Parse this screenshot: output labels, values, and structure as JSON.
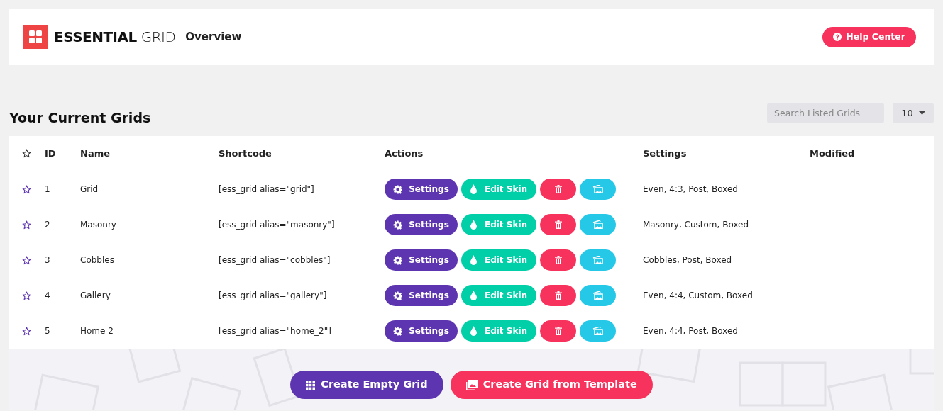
{
  "header": {
    "logo_bold": "ESSENTIAL",
    "logo_light": "GRID",
    "page_title": "Overview",
    "help_button": "Help Center"
  },
  "grids": {
    "title": "Your Current Grids",
    "search": {
      "placeholder": "Search Listed Grids"
    },
    "per_page": "10",
    "columns": [
      "ID",
      "Name",
      "Shortcode",
      "Actions",
      "Settings",
      "Modified"
    ],
    "rows": [
      {
        "id": "1",
        "name": "Grid",
        "shortcode": "[ess_grid alias=\"grid\"]",
        "settings_button": "Settings",
        "edit_skin_button": "Edit Skin",
        "settings": "Even, 4:3, Post, Boxed",
        "favorite": false
      },
      {
        "id": "2",
        "name": "Masonry",
        "shortcode": "[ess_grid alias=\"masonry\"]",
        "settings_button": "Settings",
        "edit_skin_button": "Edit Skin",
        "settings": "Masonry, Custom, Boxed",
        "favorite": false
      },
      {
        "id": "3",
        "name": "Cobbles",
        "shortcode": "[ess_grid alias=\"cobbles\"]",
        "settings_button": "Settings",
        "edit_skin_button": "Edit Skin",
        "settings": "Cobbles, Post, Boxed",
        "favorite": false
      },
      {
        "id": "4",
        "name": "Gallery",
        "shortcode": "[ess_grid alias=\"gallery\"]",
        "settings_button": "Settings",
        "edit_skin_button": "Edit Skin",
        "settings": "Even, 4:4, Custom, Boxed",
        "favorite": false
      },
      {
        "id": "5",
        "name": "Home 2",
        "shortcode": "[ess_grid alias=\"home_2\"]",
        "settings_button": "Settings",
        "edit_skin_button": "Edit Skin",
        "settings": "Even, 4:4, Post, Boxed",
        "favorite": false
      }
    ]
  },
  "footer_buttons": [
    "Create Empty Grid",
    "Create Grid from Template"
  ]
}
